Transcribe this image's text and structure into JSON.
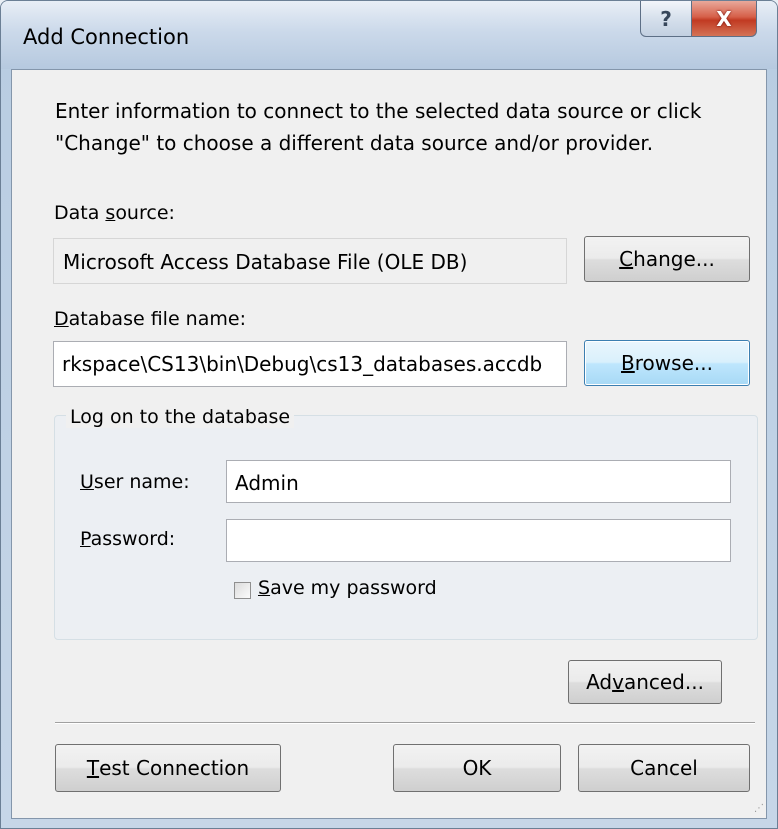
{
  "window": {
    "title": "Add Connection",
    "help_glyph": "?",
    "close_glyph": "X"
  },
  "intro_text": "Enter information to connect to the selected data source or click \"Change\" to choose a different data source and/or provider.",
  "data_source": {
    "label_prefix": "Data ",
    "label_accel": "s",
    "label_rest": "ource:",
    "value": "Microsoft Access Database File (OLE DB)",
    "change_accel": "C",
    "change_rest": "hange..."
  },
  "database_file": {
    "label_accel": "D",
    "label_rest": "atabase file name:",
    "value": "rkspace\\CS13\\bin\\Debug\\cs13_databases.accdb",
    "browse_accel": "B",
    "browse_rest": "rowse..."
  },
  "logon": {
    "legend": "Log on to the database",
    "user_accel": "U",
    "user_rest": "ser name:",
    "user_value": "Admin",
    "password_accel": "P",
    "password_rest": "assword:",
    "password_value": "",
    "save_accel": "S",
    "save_rest": "ave my password",
    "save_checked": false
  },
  "buttons": {
    "advanced_prefix": "Ad",
    "advanced_accel": "v",
    "advanced_rest": "anced...",
    "test_accel": "T",
    "test_rest": "est Connection",
    "ok": "OK",
    "cancel": "Cancel"
  },
  "resize_grip": "⋰"
}
